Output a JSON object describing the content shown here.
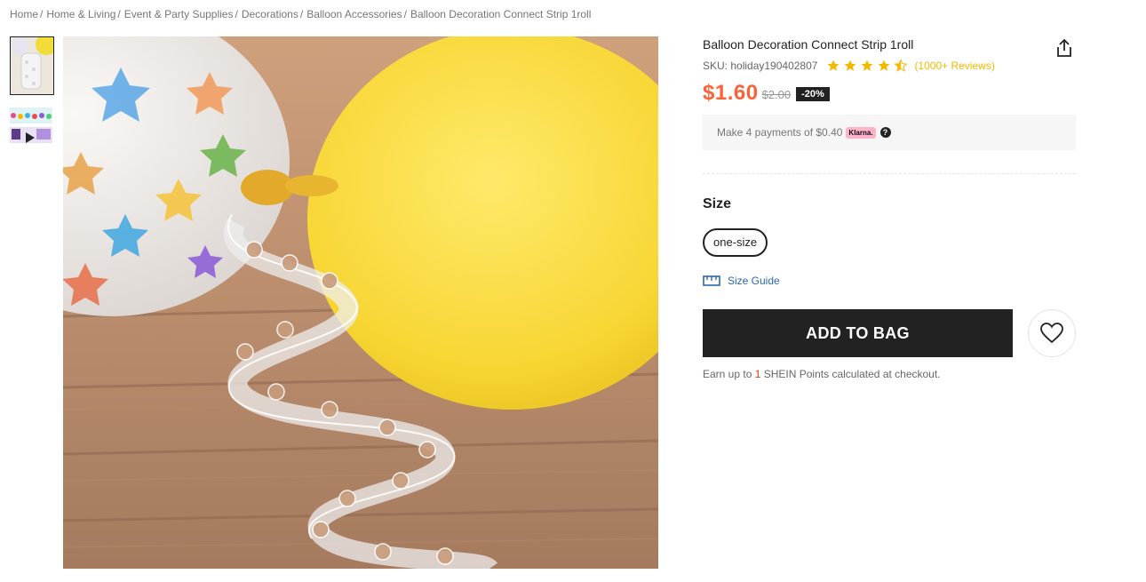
{
  "breadcrumb": {
    "items": [
      "Home",
      "Home & Living",
      "Event & Party Supplies",
      "Decorations",
      "Balloon Accessories"
    ],
    "current": "Balloon Decoration Connect Strip 1roll",
    "separator": "/"
  },
  "product": {
    "title": "Balloon Decoration Connect Strip 1roll",
    "sku_label": "SKU: holiday190402807",
    "rating": 4.5,
    "reviews": "(1000+ Reviews)",
    "price": "$1.60",
    "original_price": "$2.00",
    "discount": "-20%"
  },
  "klarna": {
    "text": "Make 4 payments of $0.40",
    "badge": "Klarna.",
    "help": "?"
  },
  "size": {
    "label": "Size",
    "options": [
      "one-size"
    ],
    "guide": "Size Guide"
  },
  "actions": {
    "add_to_bag": "ADD TO BAG"
  },
  "points": {
    "prefix": "Earn up to",
    "value": "1",
    "suffix": "SHEIN Points calculated at checkout."
  },
  "colors": {
    "price": "#fa6338",
    "dark": "#222222",
    "star": "#f5b800",
    "link": "#2d68a8"
  },
  "icons": {
    "share": "share-icon",
    "heart": "heart-icon",
    "ruler": "ruler-icon",
    "star": "star-icon"
  }
}
